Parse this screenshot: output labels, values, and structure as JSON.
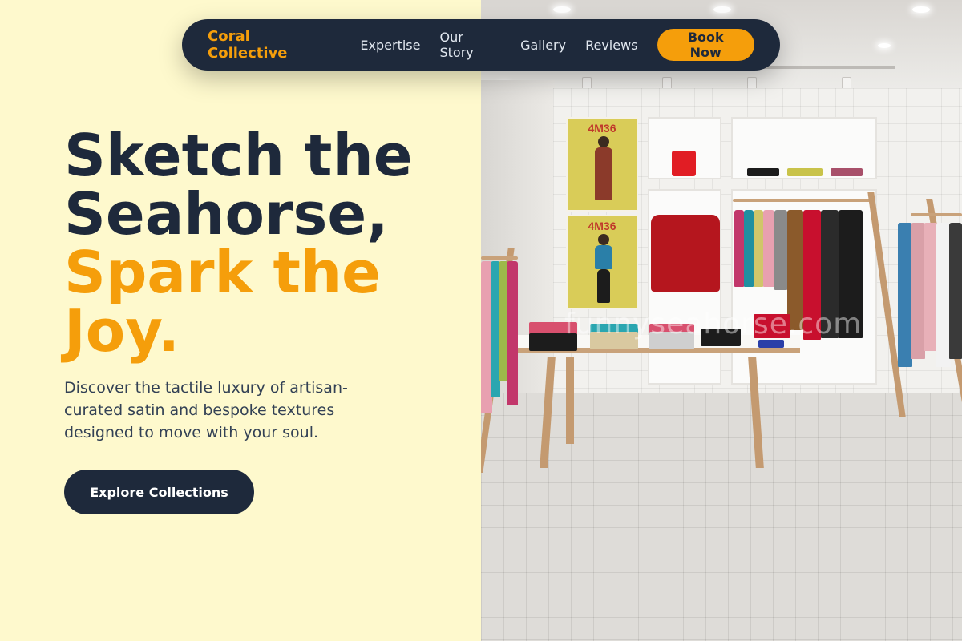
{
  "nav": {
    "brand": "Coral Collective",
    "links": [
      "Expertise",
      "Our Story",
      "Gallery",
      "Reviews"
    ],
    "cta": "Book Now"
  },
  "hero": {
    "title_lines": [
      "Sketch the",
      "Seahorse,"
    ],
    "accent_lines": [
      "Spark the",
      "Joy."
    ],
    "description": "Discover the tactile luxury of artisan-curated satin and bespoke textures designed to move with your soul.",
    "cta": "Explore Collections"
  },
  "store_image": {
    "poster_text": [
      "4M36",
      "4M36"
    ],
    "watermark": "funnyseahorse.com"
  },
  "colors": {
    "background": "#fef9cd",
    "navy": "#1e293b",
    "accent": "#f59e0b",
    "nav_text": "#e2e8f0",
    "body_text": "#334155"
  }
}
